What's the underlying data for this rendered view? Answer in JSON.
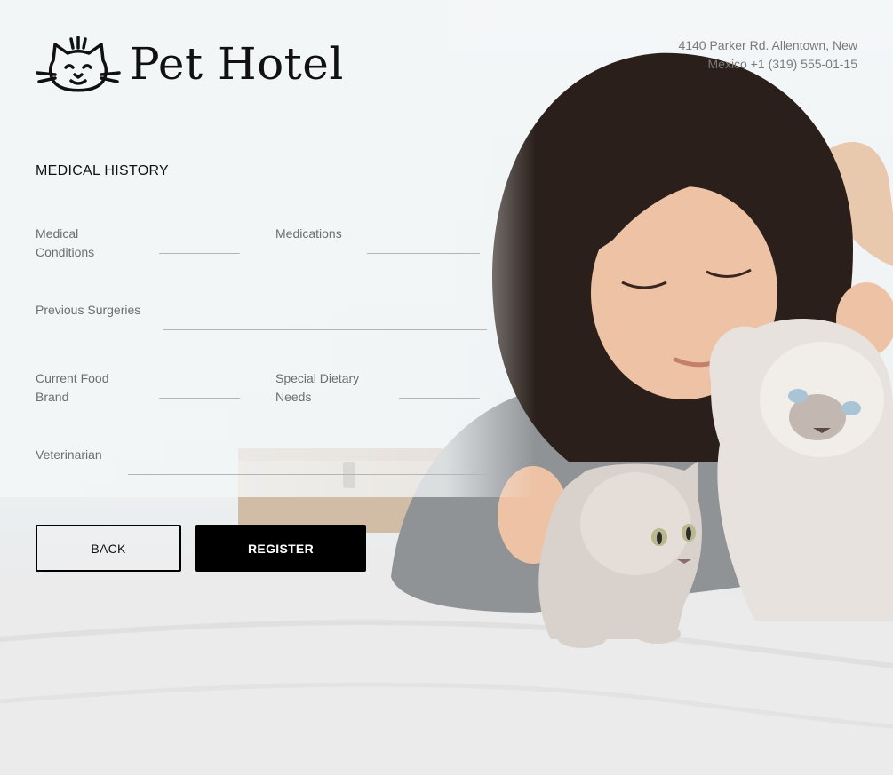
{
  "brand": {
    "name": "Pet Hotel",
    "logo_icon": "cat-face-icon"
  },
  "address": "4140 Parker Rd. Allentown, New Mexico +1 (319) 555-01-15",
  "section_title": "MEDICAL HISTORY",
  "fields": {
    "medical_conditions": {
      "label": "Medical Conditions",
      "value": ""
    },
    "medications": {
      "label": "Medications",
      "value": ""
    },
    "previous_surgeries": {
      "label": "Previous Surgeries",
      "value": ""
    },
    "current_food_brand": {
      "label": "Current Food Brand",
      "value": ""
    },
    "special_dietary_needs": {
      "label": "Special Dietary Needs",
      "value": ""
    },
    "veterinarian": {
      "label": "Veterinarian",
      "value": ""
    }
  },
  "buttons": {
    "back": "BACK",
    "register": "REGISTER"
  },
  "colors": {
    "text": "#111111",
    "muted": "#6e6e6e",
    "primary_button": "#000000",
    "line": "#b5b5b5"
  }
}
